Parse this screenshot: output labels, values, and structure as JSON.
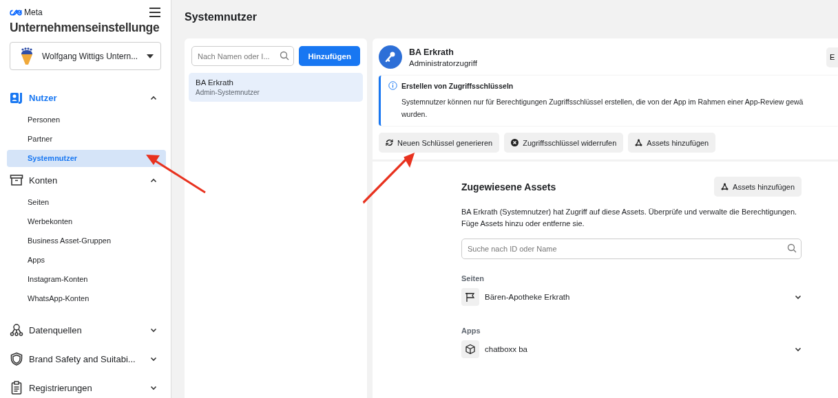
{
  "sidebar": {
    "brand": "Meta",
    "title": "Unternehmenseinstellunge",
    "account": "Wolfgang Wittigs Untern...",
    "sections": [
      {
        "label": "Nutzer",
        "expanded": true,
        "selected": true,
        "children": [
          {
            "label": "Personen",
            "selected": false
          },
          {
            "label": "Partner",
            "selected": false
          },
          {
            "label": "Systemnutzer",
            "selected": true
          }
        ]
      },
      {
        "label": "Konten",
        "expanded": true,
        "selected": false,
        "children": [
          {
            "label": "Seiten",
            "selected": false
          },
          {
            "label": "Werbekonten",
            "selected": false
          },
          {
            "label": "Business Asset-Gruppen",
            "selected": false
          },
          {
            "label": "Apps",
            "selected": false
          },
          {
            "label": "Instagram-Konten",
            "selected": false
          },
          {
            "label": "WhatsApp-Konten",
            "selected": false
          }
        ]
      },
      {
        "label": "Datenquellen",
        "expanded": false,
        "selected": false
      },
      {
        "label": "Brand Safety and Suitabi...",
        "expanded": false,
        "selected": false
      },
      {
        "label": "Registrierungen",
        "expanded": false,
        "selected": false
      }
    ]
  },
  "page_title": "Systemnutzer",
  "user_list": {
    "search": {
      "placeholder": "Nach Namen oder I..."
    },
    "add_button": "Hinzufügen",
    "items": [
      {
        "name": "BA Erkrath",
        "role": "Admin-Systemnutzer",
        "selected": true
      }
    ]
  },
  "detail": {
    "name": "BA Erkrath",
    "access": "Administratorzugriff",
    "header_button": "E",
    "notice": {
      "title": "Erstellen von Zugriffsschlüsseln",
      "lines": [
        "Systemnutzer können nur für Berechtigungen Zugriffsschlüssel erstellen, die von der App im Rahmen einer App-Review gewä",
        "wurden."
      ]
    },
    "actions": [
      {
        "label": "Neuen Schlüssel generieren"
      },
      {
        "label": "Zugriffsschlüssel widerrufen"
      },
      {
        "label": "Assets hinzufügen"
      }
    ],
    "assets": {
      "title": "Zugewiesene Assets",
      "add_button": "Assets hinzufügen",
      "description": "BA Erkrath (Systemnutzer) hat Zugriff auf diese Assets. Überprüfe und verwalte die Berechtigungen. Füge Assets hinzu oder entferne sie.",
      "search": {
        "placeholder": "Suche nach ID oder Name"
      },
      "groups": [
        {
          "label": "Seiten",
          "items": [
            {
              "name": "Bären-Apotheke Erkrath",
              "expanded": false
            }
          ]
        },
        {
          "label": "Apps",
          "items": [
            {
              "name": "chatboxx ba",
              "expanded": false
            }
          ]
        }
      ]
    }
  },
  "annotations": [
    {
      "kind": "arrow"
    },
    {
      "kind": "arrow"
    }
  ]
}
